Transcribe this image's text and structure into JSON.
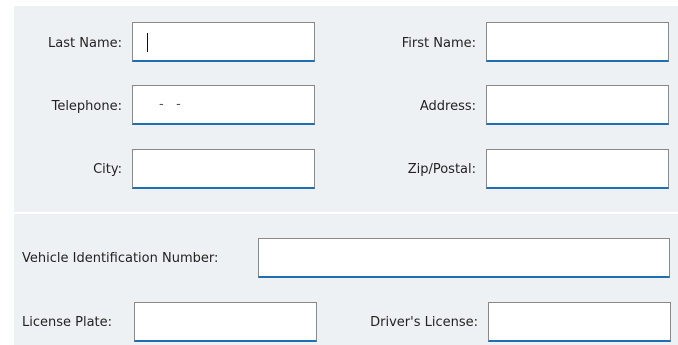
{
  "personal": {
    "last_name": {
      "label": "Last Name:",
      "value": ""
    },
    "first_name": {
      "label": "First Name:",
      "value": ""
    },
    "telephone": {
      "label": "Telephone:",
      "mask": "-   -"
    },
    "address": {
      "label": "Address:",
      "value": ""
    },
    "city": {
      "label": "City:",
      "value": ""
    },
    "zip": {
      "label": "Zip/Postal:",
      "value": ""
    }
  },
  "vehicle": {
    "vin": {
      "label": "Vehicle Identification Number:",
      "value": ""
    },
    "license_plate": {
      "label": "License Plate:",
      "value": ""
    },
    "drivers_license": {
      "label": "Driver's License:",
      "value": ""
    }
  },
  "colors": {
    "panel_bg": "#eef1f3",
    "field_border": "#8a8a8a",
    "field_underline": "#1f6fb4"
  }
}
